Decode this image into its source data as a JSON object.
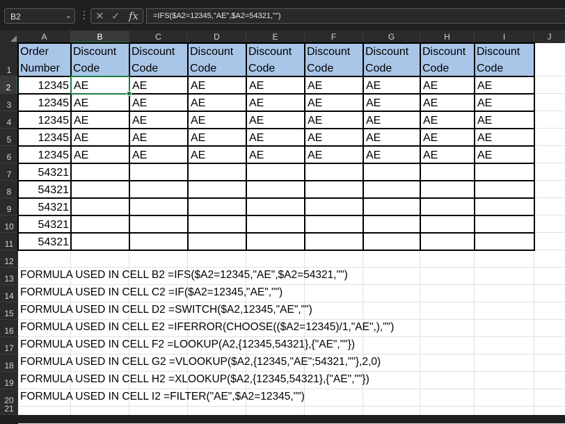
{
  "formula_bar": {
    "name_box": "B2",
    "name_box_dropdown_icon": "chevron-down-icon",
    "more_icon": "vertical-dots-icon",
    "cancel_icon": "close-icon",
    "enter_icon": "check-icon",
    "fx_label": "fx",
    "formula": "=IFS($A2=12345,\"AE\",$A2=54321,\"\")"
  },
  "columns": [
    "A",
    "B",
    "C",
    "D",
    "E",
    "F",
    "G",
    "H",
    "I",
    "J"
  ],
  "selected_column": "B",
  "rows": [
    "1",
    "2",
    "3",
    "4",
    "5",
    "6",
    "7",
    "8",
    "9",
    "10",
    "11",
    "12",
    "13",
    "14",
    "15",
    "16",
    "17",
    "18",
    "19",
    "20",
    "21"
  ],
  "selected_row": "2",
  "table": {
    "header_line1": [
      "Order",
      "Discount",
      "Discount",
      "Discount",
      "Discount",
      "Discount",
      "Discount",
      "Discount",
      "Discount"
    ],
    "header_line2": [
      "Number",
      "Code",
      "Code",
      "Code",
      "Code",
      "Code",
      "Code",
      "Code",
      "Code"
    ],
    "data": [
      [
        "12345",
        "AE",
        "AE",
        "AE",
        "AE",
        "AE",
        "AE",
        "AE",
        "AE"
      ],
      [
        "12345",
        "AE",
        "AE",
        "AE",
        "AE",
        "AE",
        "AE",
        "AE",
        "AE"
      ],
      [
        "12345",
        "AE",
        "AE",
        "AE",
        "AE",
        "AE",
        "AE",
        "AE",
        "AE"
      ],
      [
        "12345",
        "AE",
        "AE",
        "AE",
        "AE",
        "AE",
        "AE",
        "AE",
        "AE"
      ],
      [
        "12345",
        "AE",
        "AE",
        "AE",
        "AE",
        "AE",
        "AE",
        "AE",
        "AE"
      ],
      [
        "54321",
        "",
        "",
        "",
        "",
        "",
        "",
        "",
        ""
      ],
      [
        "54321",
        "",
        "",
        "",
        "",
        "",
        "",
        "",
        ""
      ],
      [
        "54321",
        "",
        "",
        "",
        "",
        "",
        "",
        "",
        ""
      ],
      [
        "54321",
        "",
        "",
        "",
        "",
        "",
        "",
        "",
        ""
      ],
      [
        "54321",
        "",
        "",
        "",
        "",
        "",
        "",
        "",
        ""
      ]
    ],
    "header_fill": "#a9c6e8"
  },
  "notes": [
    "FORMULA USED IN CELL B2 =IFS($A2=12345,\"AE\",$A2=54321,\"\")",
    "FORMULA USED IN CELL C2 =IF($A2=12345,\"AE\",\"\")",
    "FORMULA USED IN CELL D2 =SWITCH($A2,12345,\"AE\",\"\")",
    "FORMULA USED IN CELL E2 =IFERROR(CHOOSE(($A2=12345)/1,\"AE\",),\"\")",
    "FORMULA USED IN CELL F2 =LOOKUP(A2,{12345,54321},{\"AE\",\"\"})",
    "FORMULA USED IN CELL G2 =VLOOKUP($A2,{12345,\"AE\";54321,\"\"},2,0)",
    "FORMULA USED IN CELL H2 =XLOOKUP($A2,{12345,54321},{\"AE\",\"\"})",
    "FORMULA USED IN CELL I2 =FILTER(\"AE\",$A2=12345,\"\")"
  ],
  "accent_color": "#1e7b45"
}
